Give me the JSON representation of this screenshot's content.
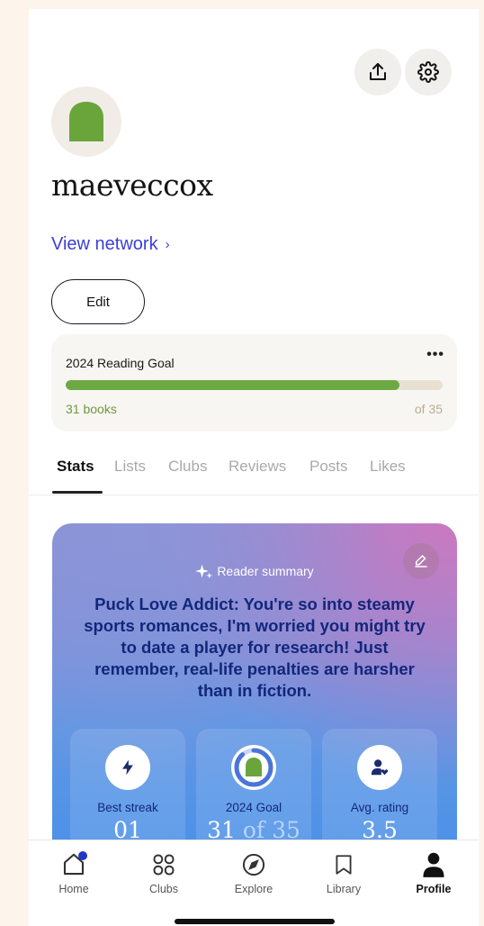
{
  "profile": {
    "username": "maeveccox",
    "view_network": "View network",
    "view_network_chevron": "›",
    "edit_label": "Edit"
  },
  "reading_goal": {
    "title": "2024 Reading Goal",
    "more": "•••",
    "count_label": "31 books",
    "total_label": "of 35",
    "progress_fraction": 0.8857
  },
  "tabs": [
    {
      "label": "Stats"
    },
    {
      "label": "Lists"
    },
    {
      "label": "Clubs"
    },
    {
      "label": "Reviews"
    },
    {
      "label": "Posts"
    },
    {
      "label": "Likes"
    }
  ],
  "summary": {
    "label": "Reader summary",
    "text": "Puck Love Addict: You're so into steamy sports romances, I'm worried you might try to date a player for research! Just remember, real-life penalties are harsher than in fiction."
  },
  "stats": [
    {
      "label": "Best streak",
      "value": "01"
    },
    {
      "label": "2024 Goal",
      "value_main": "31",
      "value_rest": " of 35"
    },
    {
      "label": "Avg. rating",
      "value": "3.5"
    }
  ],
  "tabbar": [
    {
      "label": "Home",
      "icon": "home-icon"
    },
    {
      "label": "Clubs",
      "icon": "clubs-grid-icon"
    },
    {
      "label": "Explore",
      "icon": "compass-icon"
    },
    {
      "label": "Library",
      "icon": "bookmark-icon"
    },
    {
      "label": "Profile",
      "icon": "person-icon"
    }
  ],
  "colors": {
    "accent_green": "#6da943",
    "link_blue": "#3b3fd8",
    "summary_text": "#12277a",
    "notification_dot": "#2436c9"
  }
}
